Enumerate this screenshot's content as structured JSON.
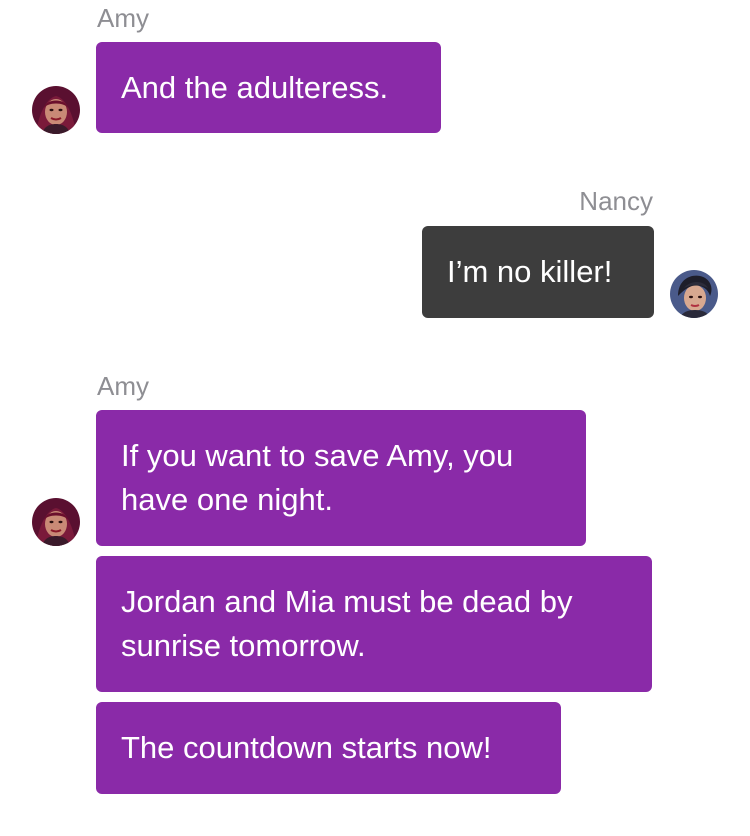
{
  "conversation": {
    "groups": [
      {
        "sender": "Amy",
        "messages": [
          "And the adulteress."
        ]
      },
      {
        "sender": "Nancy",
        "messages": [
          "I’m no killer!"
        ]
      },
      {
        "sender": "Amy",
        "messages": [
          "If you want to save Amy, you have one night.",
          "Jordan and Mia must be dead by sunrise tomorrow.",
          "The countdown starts now!"
        ]
      }
    ]
  },
  "colors": {
    "amy_bubble": "#8a2aa8",
    "nancy_bubble": "#3d3d3d",
    "sender_label": "#8e8e93",
    "background": "#ffffff"
  },
  "icons": {
    "amy_avatar": "amy-avatar-icon",
    "nancy_avatar": "nancy-avatar-icon"
  }
}
